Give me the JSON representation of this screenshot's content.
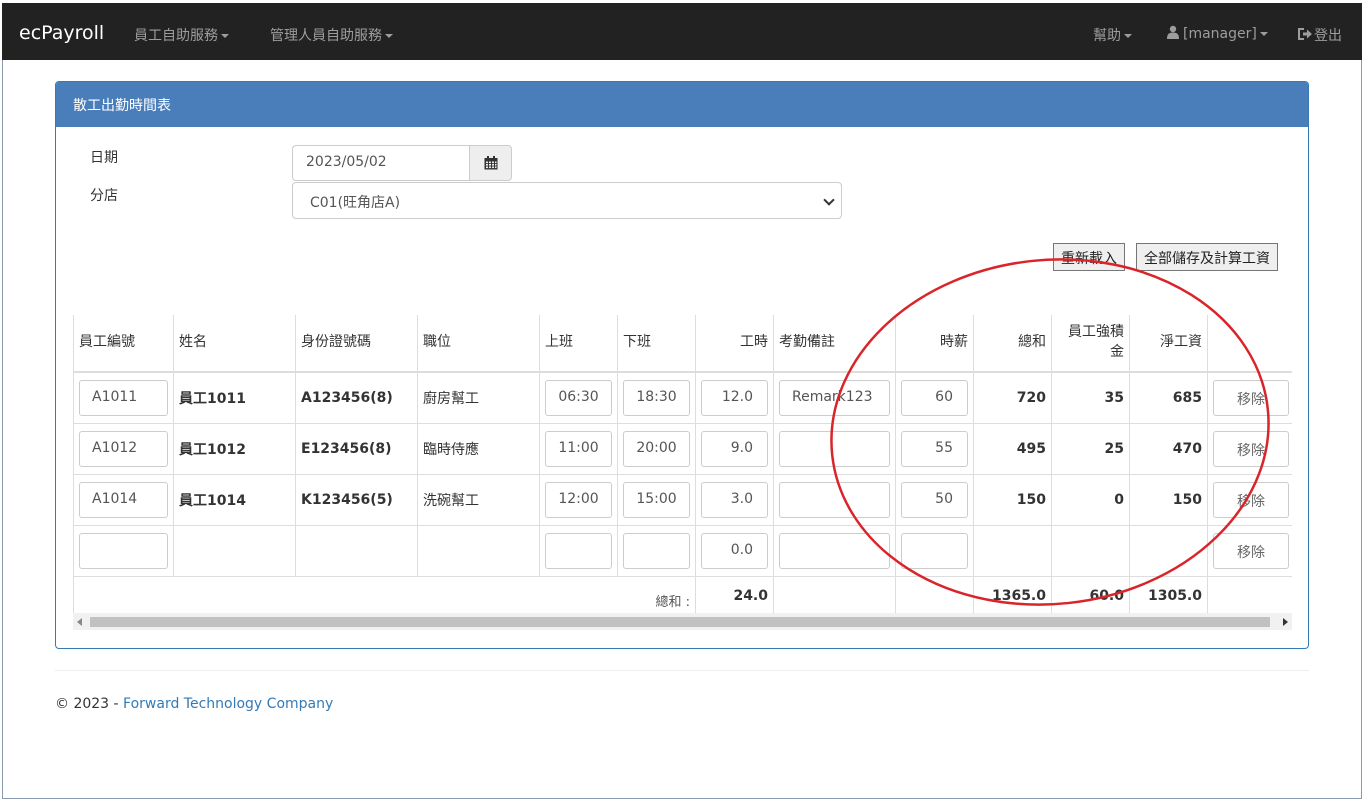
{
  "nav": {
    "brand": "ecPayroll",
    "menu_employee": "員工自助服務",
    "menu_manager": "管理人員自助服務",
    "help": "幫助",
    "user": "[manager]",
    "logout": "登出"
  },
  "panel": {
    "title": "散工出勤時間表",
    "date_label": "日期",
    "date_value": "2023/05/02",
    "branch_label": "分店",
    "branch_value": "C01(旺角店A)",
    "reload_button": "重新載入",
    "save_all_button": "全部儲存及計算工資"
  },
  "table": {
    "headers": {
      "emp_no": "員工編號",
      "name": "姓名",
      "id_no": "身份證號碼",
      "position": "職位",
      "start": "上班",
      "end": "下班",
      "hours": "工時",
      "remark": "考勤備註",
      "rate": "時薪",
      "total": "總和",
      "mpf": "員工強積金",
      "net": "淨工資"
    },
    "rows": [
      {
        "emp_no": "A1011",
        "name": "員工1011",
        "id_no": "A123456(8)",
        "position": "廚房幫工",
        "start": "06:30",
        "end": "18:30",
        "hours": "12.0",
        "remark": "Remark123",
        "rate": "60",
        "total": "720",
        "mpf": "35",
        "net": "685",
        "remove": "移除"
      },
      {
        "emp_no": "A1012",
        "name": "員工1012",
        "id_no": "E123456(8)",
        "position": "臨時侍應",
        "start": "11:00",
        "end": "20:00",
        "hours": "9.0",
        "remark": "",
        "rate": "55",
        "total": "495",
        "mpf": "25",
        "net": "470",
        "remove": "移除"
      },
      {
        "emp_no": "A1014",
        "name": "員工1014",
        "id_no": "K123456(5)",
        "position": "洗碗幫工",
        "start": "12:00",
        "end": "15:00",
        "hours": "3.0",
        "remark": "",
        "rate": "50",
        "total": "150",
        "mpf": "0",
        "net": "150",
        "remove": "移除"
      },
      {
        "emp_no": "",
        "name": "",
        "id_no": "",
        "position": "",
        "start": "",
        "end": "",
        "hours": "0.0",
        "remark": "",
        "rate": "",
        "total": "",
        "mpf": "",
        "net": "",
        "remove": "移除"
      }
    ],
    "totals": {
      "label": "總和 :",
      "hours": "24.0",
      "total": "1365.0",
      "mpf": "60.0",
      "net": "1305.0"
    }
  },
  "footer": {
    "copyright": "© 2023 -",
    "company": "Forward Technology Company"
  },
  "colors": {
    "navbar": "#222222",
    "panel_heading": "#4a7ebb",
    "link": "#337ab7",
    "annotation": "#d9252a"
  }
}
